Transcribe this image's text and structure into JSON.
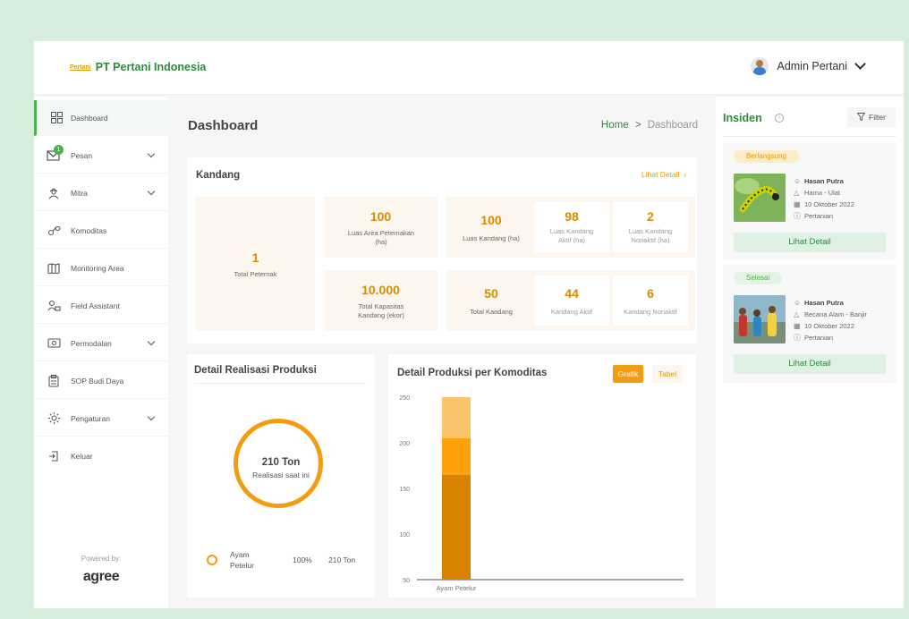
{
  "header": {
    "logo_mark": "Pertani",
    "company": "PT Pertani Indonesia",
    "user_name": "Admin Pertani"
  },
  "sidebar": {
    "items": [
      {
        "label": "Dashboard",
        "icon": "grid-icon"
      },
      {
        "label": "Pesan",
        "icon": "mail-icon",
        "badge": "1"
      },
      {
        "label": "Mitra",
        "icon": "user-tie-icon"
      },
      {
        "label": "Komoditas",
        "icon": "link-icon"
      },
      {
        "label": "Monitoring Area",
        "icon": "map-icon"
      },
      {
        "label": "Field Assistant",
        "icon": "users-icon"
      },
      {
        "label": "Permodalan",
        "icon": "money-icon"
      },
      {
        "label": "SOP Budi Daya",
        "icon": "clipboard-icon"
      },
      {
        "label": "Pengaturan",
        "icon": "gear-icon"
      },
      {
        "label": "Keluar",
        "icon": "logout-icon"
      }
    ],
    "powered_by": "Powered by:",
    "brand": "agree"
  },
  "main": {
    "title": "Dashboard",
    "breadcrumb": {
      "home": "Home",
      "separator": ">",
      "current": "Dashboard"
    },
    "kandang": {
      "title": "Kandang",
      "lihat_detail": "Lihat Detail",
      "total_peternak": {
        "value": "1",
        "label": "Total Peternak"
      },
      "luas_area": {
        "value": "100",
        "label": "Luas Area Peternakan (ha)"
      },
      "total_kapasitas": {
        "value": "10.000",
        "label": "Total Kapasitas Kandang (ekor)"
      },
      "luas_kandang": {
        "value": "100",
        "label": "Luas Kandang (ha)"
      },
      "luas_aktif": {
        "value": "98",
        "label": "Luas Kandang Aktif (ha)"
      },
      "luas_nonaktif": {
        "value": "2",
        "label": "Luas Kandang Nonaktif (ha)"
      },
      "total_kandang": {
        "value": "50",
        "label": "Total Kandang"
      },
      "kandang_aktif": {
        "value": "44",
        "label": "Kandang Aktif"
      },
      "kandang_nonaktif": {
        "value": "6",
        "label": "Kandang Nonaktif"
      }
    },
    "realisasi": {
      "title": "Detail Realisasi Produksi",
      "center_value": "210 Ton",
      "center_label": "Realisasi saat ini",
      "legend": {
        "name": "Ayam Petelur",
        "percent": "100%",
        "value": "210 Ton"
      }
    },
    "komoditas": {
      "title": "Detail Produksi per Komoditas",
      "tab_grafik": "Grafik",
      "tab_tabel": "Tabel"
    }
  },
  "chart_data": {
    "type": "bar",
    "categories": [
      "Ayam Petelur"
    ],
    "series": [
      {
        "values": [
          165
        ],
        "color": "#d98200"
      },
      {
        "values": [
          40
        ],
        "color": "#ffa10a"
      },
      {
        "values": [
          45
        ],
        "color": "#fbc36b"
      }
    ],
    "stacked": true,
    "yticks": [
      "50",
      "100",
      "150",
      "200",
      "250"
    ],
    "ylim": [
      50,
      250
    ]
  },
  "insiden": {
    "title": "Insiden",
    "filter": "Filter",
    "items": [
      {
        "status": "Berlangsung",
        "name": "Hasan Putra",
        "type": "Hama - Ulat",
        "date": "10 Oktober 2022",
        "category": "Pertanian",
        "button": "Lihat Detail"
      },
      {
        "status": "Selesai",
        "name": "Hasan Putra",
        "type": "Becana Alam - Banjir",
        "date": "10 Oktober 2022",
        "category": "Pertanian",
        "button": "Lihat Detail"
      }
    ]
  },
  "colors": {
    "brand_green": "#2e8b3a",
    "accent_orange": "#f39c12"
  }
}
